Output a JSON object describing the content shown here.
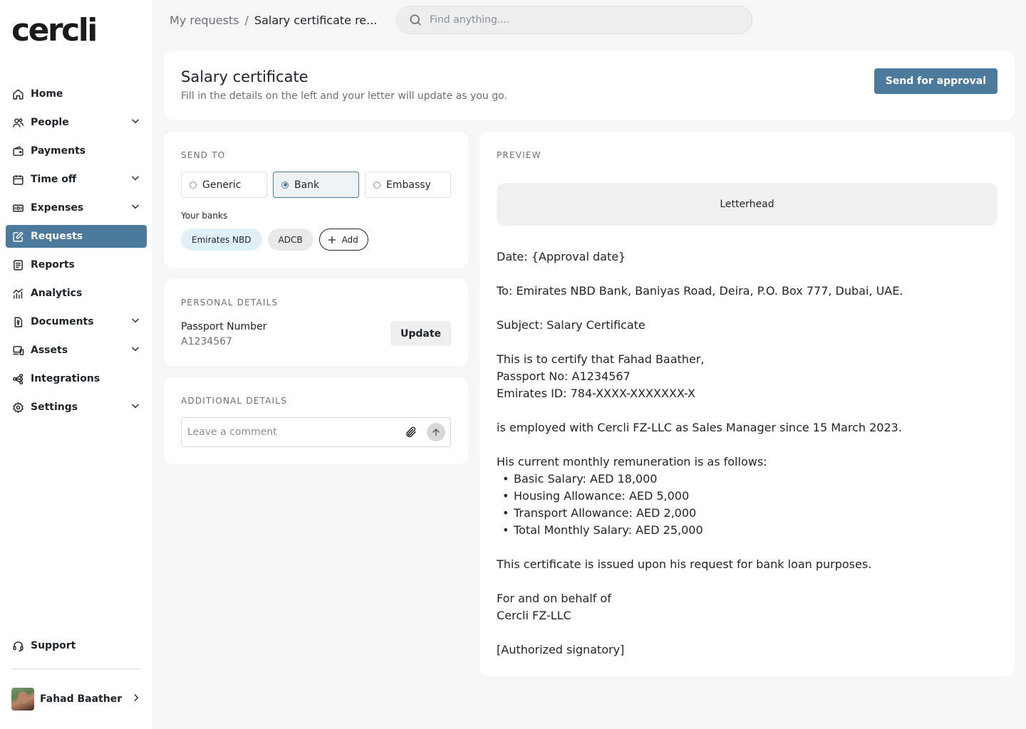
{
  "app": {
    "logo": "cercli"
  },
  "sidebar": {
    "items": [
      {
        "label": "Home",
        "icon": "home-icon",
        "has_chevron": false
      },
      {
        "label": "People",
        "icon": "people-icon",
        "has_chevron": true
      },
      {
        "label": "Payments",
        "icon": "wallet-icon",
        "has_chevron": false
      },
      {
        "label": "Time off",
        "icon": "calendar-icon",
        "has_chevron": true
      },
      {
        "label": "Expenses",
        "icon": "cash-icon",
        "has_chevron": true
      },
      {
        "label": "Requests",
        "icon": "edit-icon",
        "has_chevron": false,
        "active": true
      },
      {
        "label": "Reports",
        "icon": "report-icon",
        "has_chevron": false
      },
      {
        "label": "Analytics",
        "icon": "analytics-icon",
        "has_chevron": false
      },
      {
        "label": "Documents",
        "icon": "document-icon",
        "has_chevron": true
      },
      {
        "label": "Assets",
        "icon": "devices-icon",
        "has_chevron": true
      },
      {
        "label": "Integrations",
        "icon": "integrations-icon",
        "has_chevron": false
      },
      {
        "label": "Settings",
        "icon": "gear-icon",
        "has_chevron": true
      }
    ],
    "support_label": "Support",
    "user_name": "Fahad Baather"
  },
  "breadcrumb": {
    "parent": "My requests",
    "separator": "/",
    "current": "Salary certificate re..."
  },
  "search": {
    "placeholder": "Find anything...."
  },
  "header": {
    "title": "Salary certificate",
    "subtitle": "Fill in the details on the left and your letter will update as you go.",
    "primary_action": "Send for approval"
  },
  "send_to": {
    "label": "SEND TO",
    "options": [
      "Generic",
      "Bank",
      "Embassy"
    ],
    "selected": "Bank",
    "banks_label": "Your banks",
    "banks": [
      "Emirates NBD",
      "ADCB"
    ],
    "add_label": "Add"
  },
  "personal": {
    "label": "PERSONAL DETAILS",
    "field_label": "Passport Number",
    "field_value": "A1234567",
    "update_label": "Update"
  },
  "additional": {
    "label": "ADDITIONAL DETAILS",
    "comment_placeholder": "Leave a comment"
  },
  "preview": {
    "label": "PREVIEW",
    "letterhead": "Letterhead",
    "date": "Date: {Approval date}",
    "to": "To: Emirates NBD Bank, Baniyas Road, Deira, P.O. Box 777, Dubai, UAE.",
    "subject": "Subject: Salary Certificate",
    "certify": "This is to certify that Fahad Baather,",
    "passport": "Passport No: A1234567",
    "emirates_id": "Emirates ID: 784-XXXX-XXXXXXX-X",
    "employment": "is employed with Cercli FZ-LLC as Sales Manager since 15 March 2023.",
    "remuneration_intro": "His current monthly remuneration is as follows:",
    "remuneration": [
      "Basic Salary: AED 18,000",
      "Housing Allowance: AED 5,000",
      "Transport Allowance: AED 2,000",
      "Total Monthly Salary: AED 25,000"
    ],
    "purpose": "This certificate is issued upon his request for bank loan purposes.",
    "behalf": "For and on behalf of",
    "company": "Cercli FZ-LLC",
    "signatory": "[Authorized signatory]"
  },
  "colors": {
    "accent": "#4b7a9c",
    "chip_highlight": "#dff0f9",
    "page_bg": "#f6f6f6"
  }
}
